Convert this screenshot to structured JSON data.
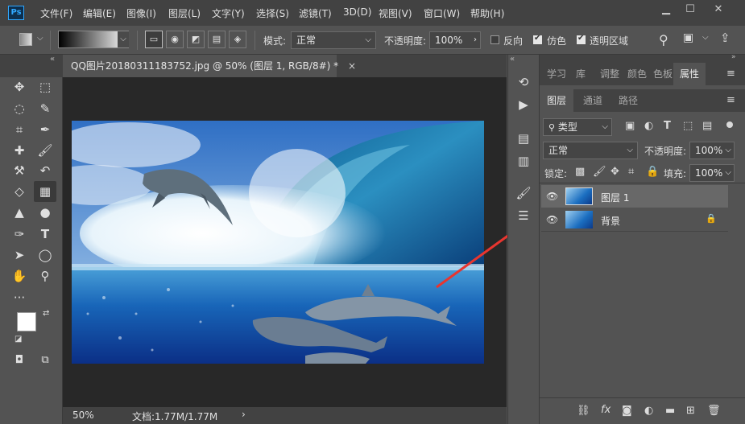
{
  "app": {
    "logo_text": "Ps"
  },
  "menu": [
    {
      "id": "file",
      "label": "文件(F)"
    },
    {
      "id": "edit",
      "label": "编辑(E)"
    },
    {
      "id": "image",
      "label": "图像(I)"
    },
    {
      "id": "layer",
      "label": "图层(L)"
    },
    {
      "id": "type",
      "label": "文字(Y)"
    },
    {
      "id": "select",
      "label": "选择(S)"
    },
    {
      "id": "filter",
      "label": "滤镜(T)"
    },
    {
      "id": "3d",
      "label": "3D(D)"
    },
    {
      "id": "view",
      "label": "视图(V)"
    },
    {
      "id": "window",
      "label": "窗口(W)"
    },
    {
      "id": "help",
      "label": "帮助(H)"
    }
  ],
  "options": {
    "mode_label": "模式:",
    "mode_value": "正常",
    "opacity_label": "不透明度:",
    "opacity_value": "100%",
    "reverse_label": "反向",
    "dither_label": "仿色",
    "transparency_label": "透明区域",
    "reverse_checked": false,
    "dither_checked": true,
    "transparency_checked": true
  },
  "document": {
    "tab_title": "QQ图片20180311183752.jpg @ 50% (图层 1, RGB/8#) *",
    "close_symbol": "×"
  },
  "status": {
    "zoom": "50%",
    "doc_info": "文档:1.77M/1.77M",
    "arrow": "›"
  },
  "properties_tabs": [
    "学习",
    "库",
    "调整",
    "颜色",
    "色板",
    "属性"
  ],
  "active_properties_tab": "属性",
  "layers_tabs": [
    "图层",
    "通道",
    "路径"
  ],
  "active_layers_tab": "图层",
  "layers_panel": {
    "filter_kind": "类型",
    "blend_mode": "正常",
    "opacity_label": "不透明度:",
    "opacity_value": "100%",
    "lock_label": "锁定:",
    "fill_label": "填充:",
    "fill_value": "100%"
  },
  "layers": [
    {
      "name": "图层 1",
      "visible": true,
      "selected": true,
      "locked": false
    },
    {
      "name": "背景",
      "visible": true,
      "selected": false,
      "locked": true
    }
  ],
  "colors": {
    "foreground": "#ffffff",
    "background": "#1ce5dd",
    "annotation_arrow": "#e8352f"
  }
}
